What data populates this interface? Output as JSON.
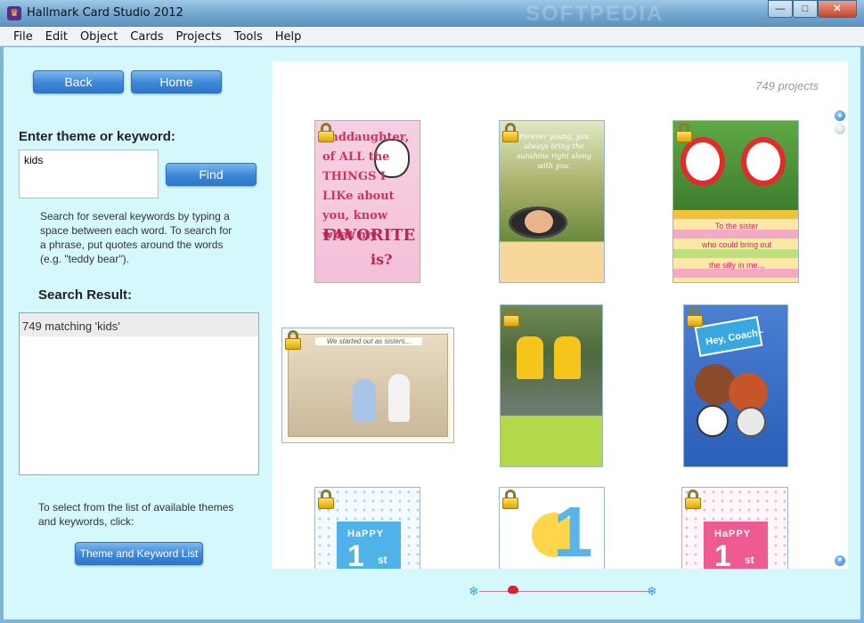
{
  "window": {
    "title": "Hallmark Card Studio 2012",
    "watermark": "SOFTPEDIA",
    "controls": {
      "minimize": "—",
      "maximize": "□",
      "close": "✕"
    }
  },
  "menu": [
    "File",
    "Edit",
    "Object",
    "Cards",
    "Projects",
    "Tools",
    "Help"
  ],
  "nav": {
    "back": "Back",
    "home": "Home"
  },
  "search": {
    "heading": "Enter theme or keyword:",
    "value": "kids",
    "find_label": "Find",
    "help": [
      "Search for several keywords by typing a",
      "space between each word. To search for",
      "a phrase, put quotes around the words",
      "(e.g. \"teddy bear\")."
    ]
  },
  "results": {
    "heading": "Search Result:",
    "items": [
      "749 matching 'kids'"
    ]
  },
  "themes": {
    "help": [
      "To select from the list of available themes",
      "and keywords, click:"
    ],
    "button_label": "Theme and Keyword List"
  },
  "gallery": {
    "count": "749 projects",
    "watermark": "SOFTPEDIA",
    "cards": [
      {
        "name": "granddaughter-card",
        "locked": true,
        "text": "anddaughter, of ALL the THINGS I LIKe about you, know what my",
        "text2": "FAVORITE",
        "text3": "is?"
      },
      {
        "name": "sunshine-card",
        "locked": true,
        "text": "Forever young, you always bring the sunshine right along with you."
      },
      {
        "name": "sister-clowns-card",
        "locked": true,
        "lines": [
          "To the sister",
          "who could bring out",
          "the silly in me..."
        ]
      },
      {
        "name": "started-out-sisters-card",
        "locked": true,
        "caption": "We started out as sisters..."
      },
      {
        "name": "raincoat-kids-card",
        "locked": true
      },
      {
        "name": "coach-card",
        "locked": true,
        "text": "Hey, Coach~"
      },
      {
        "name": "happy-1st-blue-card",
        "locked": true,
        "happy": "HaPPY",
        "num": "1",
        "suffix": "st"
      },
      {
        "name": "big-one-card",
        "locked": true,
        "num": "1"
      },
      {
        "name": "happy-1st-pink-card",
        "locked": true,
        "happy": "HaPPY",
        "num": "1",
        "suffix": "st"
      }
    ]
  },
  "colors": {
    "client_bg": "#d4f8fb",
    "button_blue": "#3c87d8",
    "card_accent": "#d2335b"
  }
}
